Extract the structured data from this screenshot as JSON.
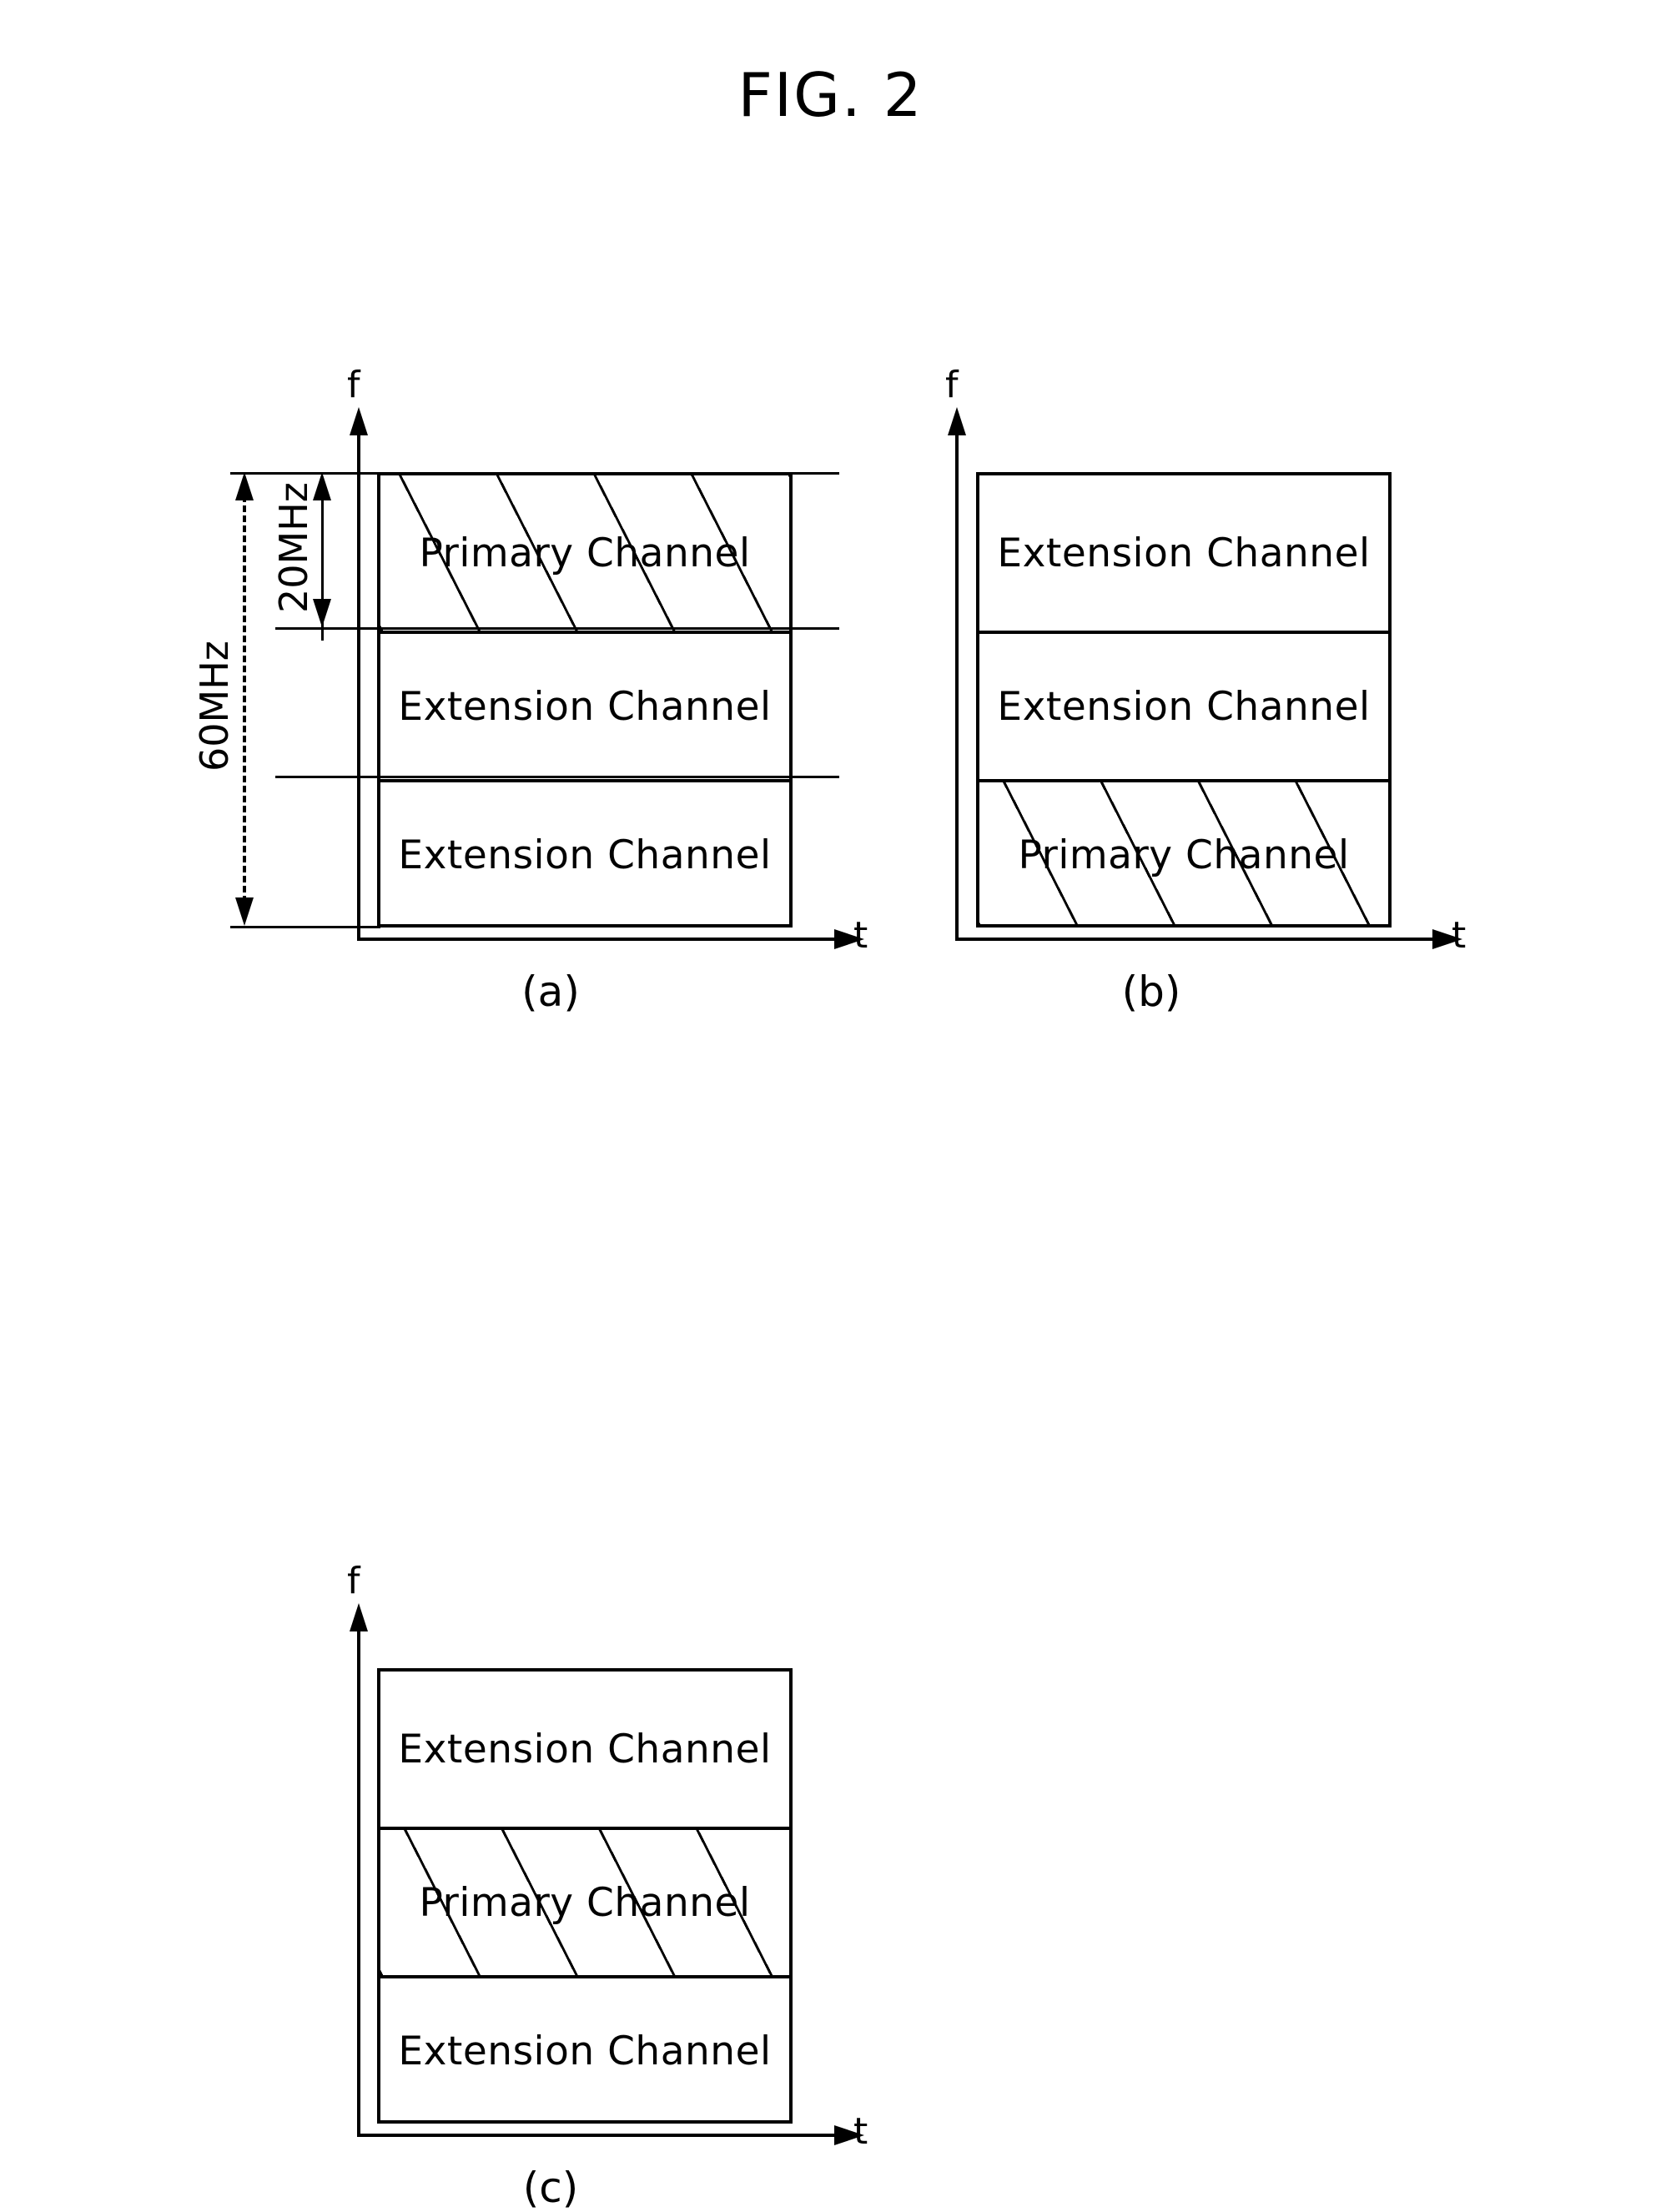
{
  "figure": {
    "title": "FIG. 2",
    "type": "patent-diagram",
    "description": "Channel bandwidth allocation diagrams showing primary and extension channel positions"
  },
  "panels": [
    {
      "id": "a",
      "caption": "(a)",
      "y_axis_label": "f",
      "x_axis_label": "t",
      "total_bandwidth_label": "60MHz",
      "subchannel_bandwidth_label": "20MHz",
      "channels": [
        {
          "label": "Primary Channel",
          "hatched": true
        },
        {
          "label": "Extension Channel",
          "hatched": false
        },
        {
          "label": "Extension Channel",
          "hatched": false
        }
      ]
    },
    {
      "id": "b",
      "caption": "(b)",
      "y_axis_label": "f",
      "x_axis_label": "t",
      "channels": [
        {
          "label": "Extension Channel",
          "hatched": false
        },
        {
          "label": "Extension Channel",
          "hatched": false
        },
        {
          "label": "Primary Channel",
          "hatched": true
        }
      ]
    },
    {
      "id": "c",
      "caption": "(c)",
      "y_axis_label": "f",
      "x_axis_label": "t",
      "channels": [
        {
          "label": "Extension Channel",
          "hatched": false
        },
        {
          "label": "Primary Channel",
          "hatched": true
        },
        {
          "label": "Extension Channel",
          "hatched": false
        }
      ]
    }
  ],
  "colors": {
    "ink": "#000000",
    "background": "#ffffff"
  }
}
